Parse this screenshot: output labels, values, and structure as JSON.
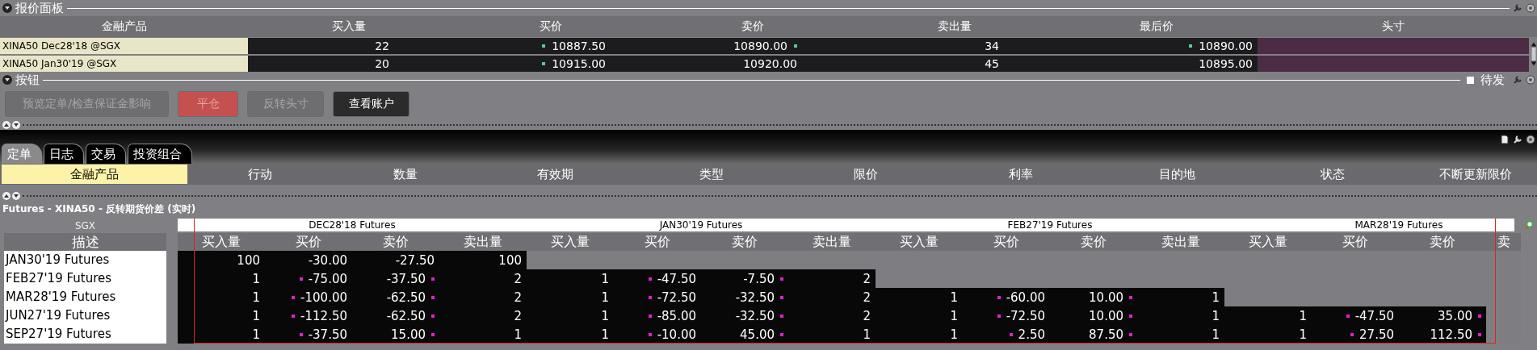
{
  "quote_panel": {
    "title": "报价面板",
    "columns": [
      "金融产品",
      "买入量",
      "买价",
      "卖价",
      "卖出量",
      "最后价",
      "头寸"
    ],
    "rows": [
      {
        "product": "XINA50 Dec28'18 @SGX",
        "bid_size": "22",
        "bid": "10887.50",
        "ask": "10890.00",
        "ask_size": "34",
        "last": "10890.00",
        "bid_mark": true,
        "ask_mark": true,
        "last_mark": true
      },
      {
        "product": "XINA50 Jan30'19 @SGX",
        "bid_size": "20",
        "bid": "10915.00",
        "ask": "10920.00",
        "ask_size": "45",
        "last": "10895.00",
        "bid_mark": true,
        "ask_mark": false,
        "last_mark": false
      }
    ]
  },
  "buttons_panel": {
    "title": "按钮",
    "pending": {
      "label": "待发",
      "checked": false
    },
    "buttons": [
      {
        "label": "预览定单/检查保证金影响",
        "kind": "neutral",
        "disabled": true
      },
      {
        "label": "平仓",
        "kind": "danger",
        "disabled": true
      },
      {
        "label": "反转头寸",
        "kind": "neutral",
        "disabled": true
      },
      {
        "label": "查看账户",
        "kind": "neutral",
        "disabled": false
      }
    ]
  },
  "tabs": [
    {
      "label": "定单",
      "selected": true
    },
    {
      "label": "日志",
      "selected": false
    },
    {
      "label": "交易",
      "selected": false
    },
    {
      "label": "投资组合",
      "selected": false
    }
  ],
  "order_columns": [
    {
      "label": "金融产品",
      "selected": true
    },
    {
      "label": "行动",
      "selected": false
    },
    {
      "label": "数量",
      "selected": false
    },
    {
      "label": "有效期",
      "selected": false
    },
    {
      "label": "类型",
      "selected": false
    },
    {
      "label": "限价",
      "selected": false
    },
    {
      "label": "利率",
      "selected": false
    },
    {
      "label": "目的地",
      "selected": false
    },
    {
      "label": "状态",
      "selected": false
    },
    {
      "label": "不断更新限价",
      "selected": false
    }
  ],
  "spread": {
    "title": "Futures - XINA50 - 反转期货价差 (实时)",
    "exchange": "SGX",
    "desc_header": "描述",
    "groups": [
      "DEC28'18 Futures",
      "JAN30'19 Futures",
      "FEB27'19 Futures",
      "MAR28'19 Futures"
    ],
    "columns": [
      "买入量",
      "买价",
      "卖价",
      "卖出量",
      "买入量",
      "买价",
      "卖价",
      "卖出量",
      "买入量",
      "买价",
      "卖价",
      "卖出量",
      "买入量",
      "买价",
      "卖价",
      "卖"
    ],
    "rows": [
      {
        "description": "JAN30'19 Futures",
        "flagged": false,
        "values": [
          "100",
          "-30.00",
          "-27.50",
          "100"
        ]
      },
      {
        "description": "FEB27'19 Futures",
        "flagged": true,
        "values": [
          "1",
          "-75.00",
          "-37.50",
          "2",
          "1",
          "-47.50",
          "-7.50",
          "2"
        ]
      },
      {
        "description": "MAR28'19 Futures",
        "flagged": true,
        "values": [
          "1",
          "-100.00",
          "-62.50",
          "2",
          "1",
          "-72.50",
          "-32.50",
          "2",
          "1",
          "-60.00",
          "10.00",
          "1"
        ]
      },
      {
        "description": "JUN27'19 Futures",
        "flagged": true,
        "values": [
          "1",
          "-112.50",
          "-62.50",
          "2",
          "1",
          "-85.00",
          "-32.50",
          "2",
          "1",
          "-72.50",
          "10.00",
          "1",
          "1",
          "-47.50",
          "35.00"
        ]
      },
      {
        "description": "SEP27'19 Futures",
        "flagged": true,
        "values": [
          "1",
          "-37.50",
          "15.00",
          "1",
          "1",
          "-10.00",
          "45.00",
          "1",
          "1",
          "2.50",
          "87.50",
          "1",
          "1",
          "27.50",
          "112.50"
        ]
      }
    ]
  }
}
